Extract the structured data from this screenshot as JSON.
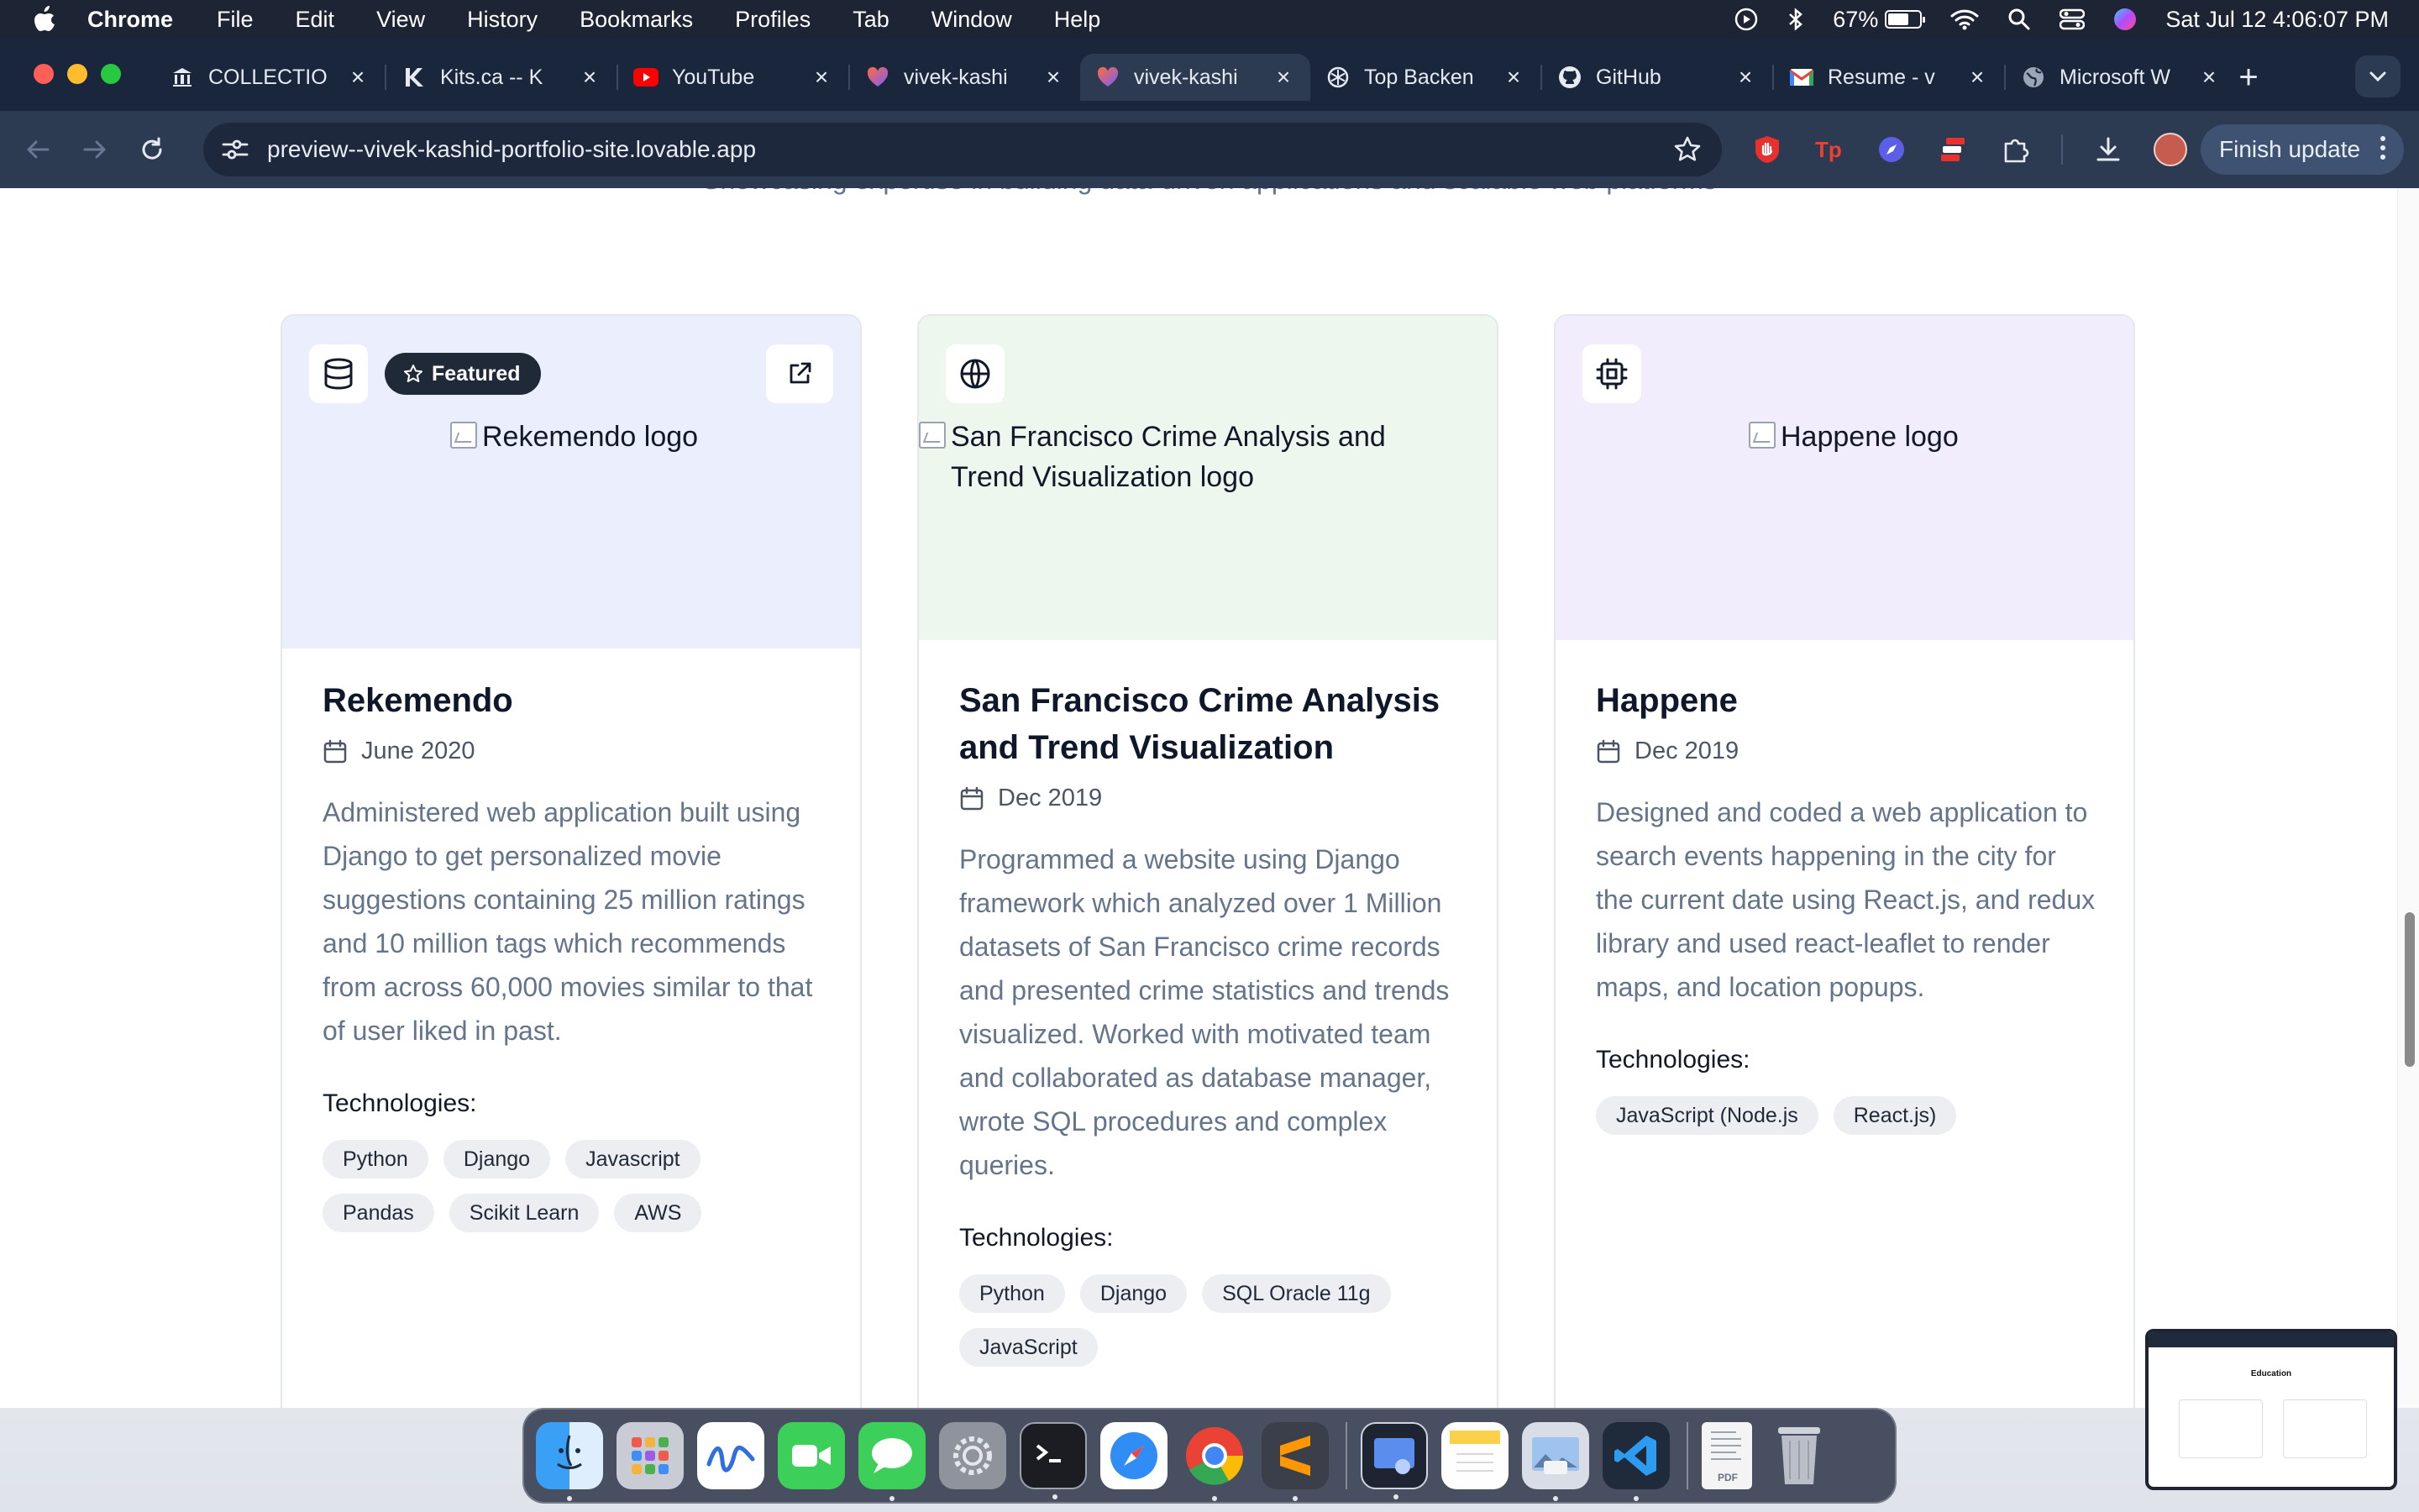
{
  "menubar": {
    "app_name": "Chrome",
    "items": [
      "File",
      "Edit",
      "View",
      "History",
      "Bookmarks",
      "Profiles",
      "Tab",
      "Window",
      "Help"
    ],
    "battery_percent": "67%",
    "battery_level": 0.67,
    "datetime": "Sat Jul 12  4:06:07 PM"
  },
  "tabs": [
    {
      "title": "COLLECTIO",
      "icon": "museum-icon",
      "active": false
    },
    {
      "title": "Kits.ca -- K",
      "icon": "kits-icon",
      "active": false
    },
    {
      "title": "YouTube",
      "icon": "youtube-icon",
      "active": false
    },
    {
      "title": "vivek-kashi",
      "icon": "lovable-icon",
      "active": false
    },
    {
      "title": "vivek-kashi",
      "icon": "lovable-icon",
      "active": true
    },
    {
      "title": "Top Backen",
      "icon": "openai-icon",
      "active": false
    },
    {
      "title": "GitHub",
      "icon": "github-icon",
      "active": false
    },
    {
      "title": "Resume - v",
      "icon": "gmail-icon",
      "active": false
    },
    {
      "title": "Microsoft W",
      "icon": "globe-icon",
      "active": false
    }
  ],
  "toolbar": {
    "url": "preview--vivek-kashid-portfolio-site.lovable.app",
    "finish_update_label": "Finish update"
  },
  "page": {
    "section_subtitle": "Showcasing expertise in building data-driven applications and scalable web platforms",
    "technologies_label": "Technologies:",
    "projects": [
      {
        "icon": "database-icon",
        "featured": true,
        "featured_label": "Featured",
        "logo_alt": "Rekemendo logo",
        "title": "Rekemendo",
        "date": "June 2020",
        "description": "Administered web application built using Django to get personalized movie suggestions containing 25 million ratings and 10 million tags which recommends from across 60,000 movies similar to that of user liked in past.",
        "technologies": [
          "Python",
          "Django",
          "Javascript",
          "Pandas",
          "Scikit Learn",
          "AWS"
        ],
        "accent": "#eaeefd"
      },
      {
        "icon": "globe-icon",
        "featured": false,
        "logo_alt": "San Francisco Crime Analysis and Trend Visualization logo",
        "title": "San Francisco Crime Analysis and Trend Visualization",
        "date": "Dec 2019",
        "description": "Programmed a website using Django framework which analyzed over 1 Million datasets of San Francisco crime records and presented crime statistics and trends visualized. Worked with motivated team and collaborated as database manager, wrote SQL procedures and complex queries.",
        "technologies": [
          "Python",
          "Django",
          "SQL Oracle 11g",
          "JavaScript"
        ],
        "accent": "#edf7ee"
      },
      {
        "icon": "cpu-chip-icon",
        "featured": false,
        "logo_alt": "Happene logo",
        "title": "Happene",
        "date": "Dec 2019",
        "description": "Designed and coded a web application to search events happening in the city for the current date using React.js, and redux library and used react-leaflet to render maps, and location popups.",
        "technologies": [
          "JavaScript (Node.js",
          "React.js)"
        ],
        "accent": "#f2edfd"
      }
    ]
  },
  "dock": {
    "apps": [
      "Finder",
      "Launchpad",
      "Freeform",
      "FaceTime",
      "Messages",
      "System Settings",
      "Terminal",
      "Safari",
      "Google Chrome",
      "Sublime Text",
      "Preview",
      "Notes",
      "Preview Image",
      "Visual Studio Code",
      "PDF Document",
      "Trash"
    ],
    "pdf_label": "PDF"
  },
  "thumbnail": {
    "title": "Education"
  }
}
